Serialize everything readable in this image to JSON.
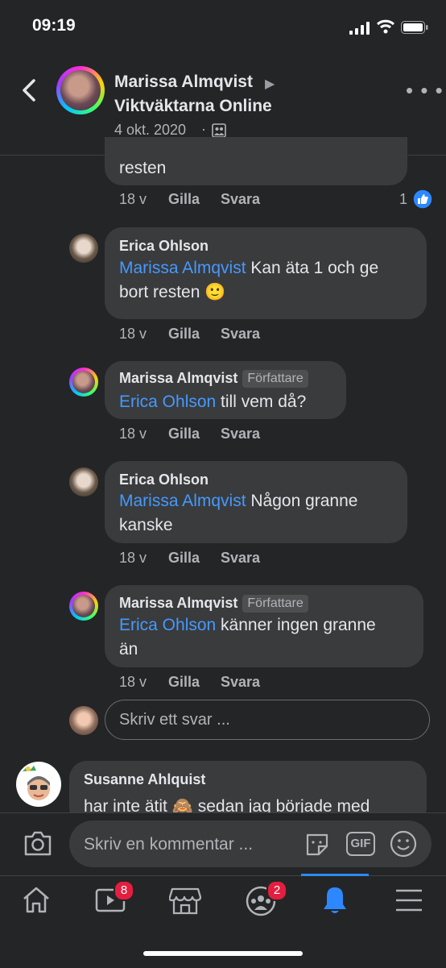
{
  "status_bar": {
    "time": "09:19"
  },
  "header": {
    "author": "Marissa Almqvist",
    "group": "Viktväktarna Online",
    "date": "4 okt. 2020",
    "separator": "·"
  },
  "comments": [
    {
      "text": "resten",
      "age": "18 v",
      "like": "Gilla",
      "reply": "Svara",
      "reactions": "1"
    },
    {
      "name": "Erica Ohlson",
      "mention": "Marissa Almqvist",
      "line1": " Kan äta 1 och ge",
      "line2": "bort resten 🙂",
      "age": "18 v",
      "like": "Gilla",
      "reply": "Svara"
    },
    {
      "name": "Marissa Almqvist",
      "tag": "Författare",
      "mention": "Erica Ohlson",
      "line1": " till vem då?",
      "age": "18 v",
      "like": "Gilla",
      "reply": "Svara"
    },
    {
      "name": "Erica Ohlson",
      "mention": "Marissa Almqvist",
      "line1": " Någon granne",
      "line2": "kanske",
      "age": "18 v",
      "like": "Gilla",
      "reply": "Svara"
    },
    {
      "name": "Marissa Almqvist",
      "tag": "Författare",
      "mention": "Erica Ohlson",
      "line1": " känner ingen granne",
      "line2": "än",
      "age": "18 v",
      "like": "Gilla",
      "reply": "Svara"
    },
    {
      "name": "Susanne Ahlquist",
      "line1": "har inte ätit 🙈 sedan jag började med"
    }
  ],
  "reply_placeholder": "Skriv ett svar ...",
  "composer": {
    "placeholder": "Skriv en kommentar ...",
    "gif": "GIF"
  },
  "tabs": [
    {
      "icon": "home-icon"
    },
    {
      "icon": "video-icon",
      "badge": "8"
    },
    {
      "icon": "marketplace-icon"
    },
    {
      "icon": "groups-icon",
      "badge": "2"
    },
    {
      "icon": "bell-icon",
      "active": true
    },
    {
      "icon": "menu-icon"
    }
  ],
  "colors": {
    "background": "#242526",
    "bubble": "#3a3b3c",
    "mention": "#4599ff",
    "active_tab": "#2d88ff",
    "badge": "#e41e3f"
  }
}
